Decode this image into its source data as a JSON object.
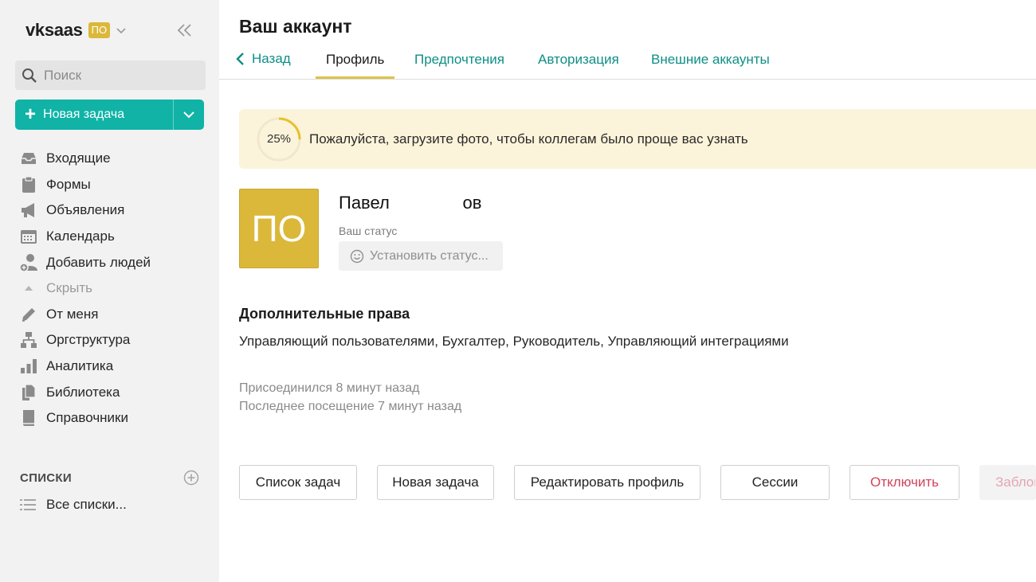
{
  "sidebar": {
    "brand": "vksaas",
    "badge": "ПО",
    "search_placeholder": "Поиск",
    "new_task_label": "Новая задача",
    "nav": [
      {
        "label": "Входящие",
        "icon": "inbox-icon"
      },
      {
        "label": "Формы",
        "icon": "clipboard-icon"
      },
      {
        "label": "Объявления",
        "icon": "megaphone-icon"
      },
      {
        "label": "Календарь",
        "icon": "calendar-icon"
      },
      {
        "label": "Добавить людей",
        "icon": "add-user-icon"
      },
      {
        "label": "Скрыть",
        "icon": "triangle-up-icon"
      },
      {
        "label": "От меня",
        "icon": "pencil-icon"
      },
      {
        "label": "Оргструктура",
        "icon": "org-chart-icon"
      },
      {
        "label": "Аналитика",
        "icon": "bar-chart-icon"
      },
      {
        "label": "Библиотека",
        "icon": "files-icon"
      },
      {
        "label": "Справочники",
        "icon": "book-icon"
      }
    ],
    "lists_title": "СПИСКИ",
    "all_lists": "Все списки..."
  },
  "header": {
    "title": "Ваш аккаунт",
    "back_label": "Назад",
    "tabs": [
      "Профиль",
      "Предпочтения",
      "Авторизация",
      "Внешние аккаунты"
    ],
    "active_tab": "Профиль"
  },
  "banner": {
    "percent_label": "25%",
    "progress": 0.25,
    "text": "Пожалуйста, загрузите фото, чтобы коллегам было проще вас узнать"
  },
  "profile": {
    "initials": "ПО",
    "name": "Павел               ов",
    "status_label": "Ваш статус",
    "status_button": "Установить статус...",
    "rights_title": "Дополнительные права",
    "rights": "Управляющий пользователями, Бухгалтер, Руководитель, Управляющий интеграциями",
    "joined": "Присоединился 8 минут назад",
    "last_seen": "Последнее посещение 7 минут назад"
  },
  "actions": [
    "Список задач",
    "Новая задача",
    "Редактировать профиль",
    "Сессии",
    "Отключить",
    "Заблокировать"
  ],
  "colors": {
    "accent": "#10b3a6",
    "link": "#0e8f86",
    "avatar": "#dbb83a",
    "banner_bg": "#fcf4da",
    "progress": "#e8c02f",
    "danger": "#d0455a"
  }
}
